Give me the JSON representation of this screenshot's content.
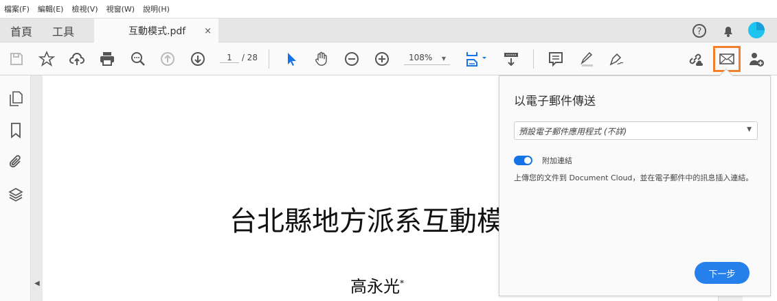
{
  "menu": [
    "檔案(F)",
    "編輯(E)",
    "檢視(V)",
    "視窗(W)",
    "說明(H)"
  ],
  "tabs": {
    "home": "首頁",
    "tools": "工具",
    "document": "互動模式.pdf",
    "close": "×"
  },
  "toolbar": {
    "page_current": "1",
    "page_total": "/ 28",
    "zoom": "108%"
  },
  "document": {
    "title": "台北縣地方派系互動模",
    "author": "高永光",
    "footnote_mark": "*"
  },
  "email_panel": {
    "heading": "以電子郵件傳送",
    "app_select": "預設電子郵件應用程式 (不詳)",
    "attach_link_label": "附加連結",
    "attach_link_on": true,
    "description": "上傳您的文件到 Document Cloud，並在電子郵件中的訊息插入連結。",
    "next_button": "下一步"
  },
  "colors": {
    "accent": "#1473e6",
    "button": "#2680eb",
    "highlight": "#f0802a"
  }
}
